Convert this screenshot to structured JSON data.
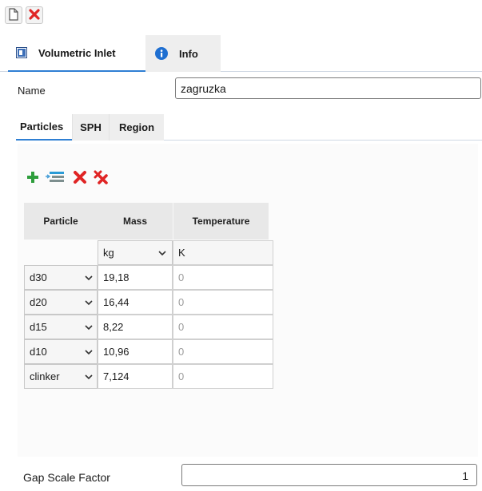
{
  "toolbar": {
    "new_icon": "document-icon",
    "delete_icon": "red-x-icon"
  },
  "main_tabs": [
    {
      "label": "Volumetric Inlet",
      "icon": "inlet-icon",
      "active": true
    },
    {
      "label": "Info",
      "icon": "info-icon",
      "active": false
    }
  ],
  "name_field": {
    "label": "Name",
    "value": "zagruzka"
  },
  "sub_tabs": [
    {
      "label": "Particles",
      "active": true
    },
    {
      "label": "SPH",
      "active": false
    },
    {
      "label": "Region",
      "active": false
    }
  ],
  "particle_toolbar": {
    "icons": [
      "add-icon",
      "edit-list-icon",
      "delete-icon",
      "delete-all-icon"
    ]
  },
  "table": {
    "headers": [
      "Particle",
      "Mass",
      "Temperature"
    ],
    "units": {
      "mass": "kg",
      "temperature": "K"
    },
    "rows": [
      {
        "particle": "d30",
        "mass": "19,18",
        "temperature": "0"
      },
      {
        "particle": "d20",
        "mass": "16,44",
        "temperature": "0"
      },
      {
        "particle": "d15",
        "mass": "8,22",
        "temperature": "0"
      },
      {
        "particle": "d10",
        "mass": "10,96",
        "temperature": "0"
      },
      {
        "particle": "clinker",
        "mass": "7,124",
        "temperature": "0"
      }
    ]
  },
  "gap_scale": {
    "label": "Gap Scale Factor",
    "value": "1"
  },
  "colors": {
    "accent_blue": "#2f7fd3",
    "add_green": "#2e9e3c",
    "delete_red": "#e02424"
  }
}
